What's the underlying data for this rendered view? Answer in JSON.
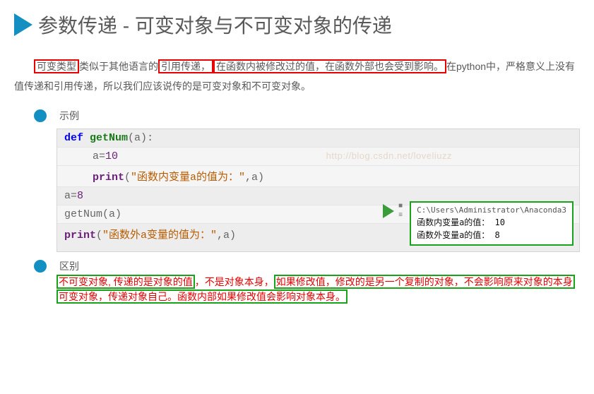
{
  "heading": "参数传递 - 可变对象与不可变对象的传递",
  "para": {
    "boxed1": "可变类型",
    "mid1": "类似于其他语言的",
    "boxed2": "引用传递，",
    "boxed3": "在函数内被修改过的值，在函数外部也会受到影响。",
    "tail": "在python中，严格意义上没有值传递和引用传递，所以我们应该说传的是可变对象和不可变对象。"
  },
  "bullet1": "示例",
  "bullet2": "区别",
  "code": {
    "def": "def",
    "fname": "getNum",
    "paren_a": "(a)",
    "colon": ":",
    "assign1": "a=",
    "ten": "10",
    "print": "print",
    "str1": "\"函数内变量a的值为：\"",
    "comma_a": ",a)",
    "lparen": "(",
    "assign2": "a=",
    "eight": "8",
    "call": "getNum(a)",
    "str2": "\"函数外a变量的值为：\"",
    "watermark": "http://blog.csdn.net/loveliuzz"
  },
  "output": {
    "path": "C:\\Users\\Administrator\\Anaconda3",
    "line1": "函数内变量a的值： 10",
    "line2": "函数外变量a的值： 8"
  },
  "diff": {
    "g1": "不可变对象, 传递的是对象的值",
    "r1": "，不是对象本身，",
    "g2": "如果修改值，修改的是另一个复制的对象，不会影响原来对象的本身",
    "g3": "可变对象，传递对象自己。函数内部如果修改值会影响对象本身。"
  }
}
